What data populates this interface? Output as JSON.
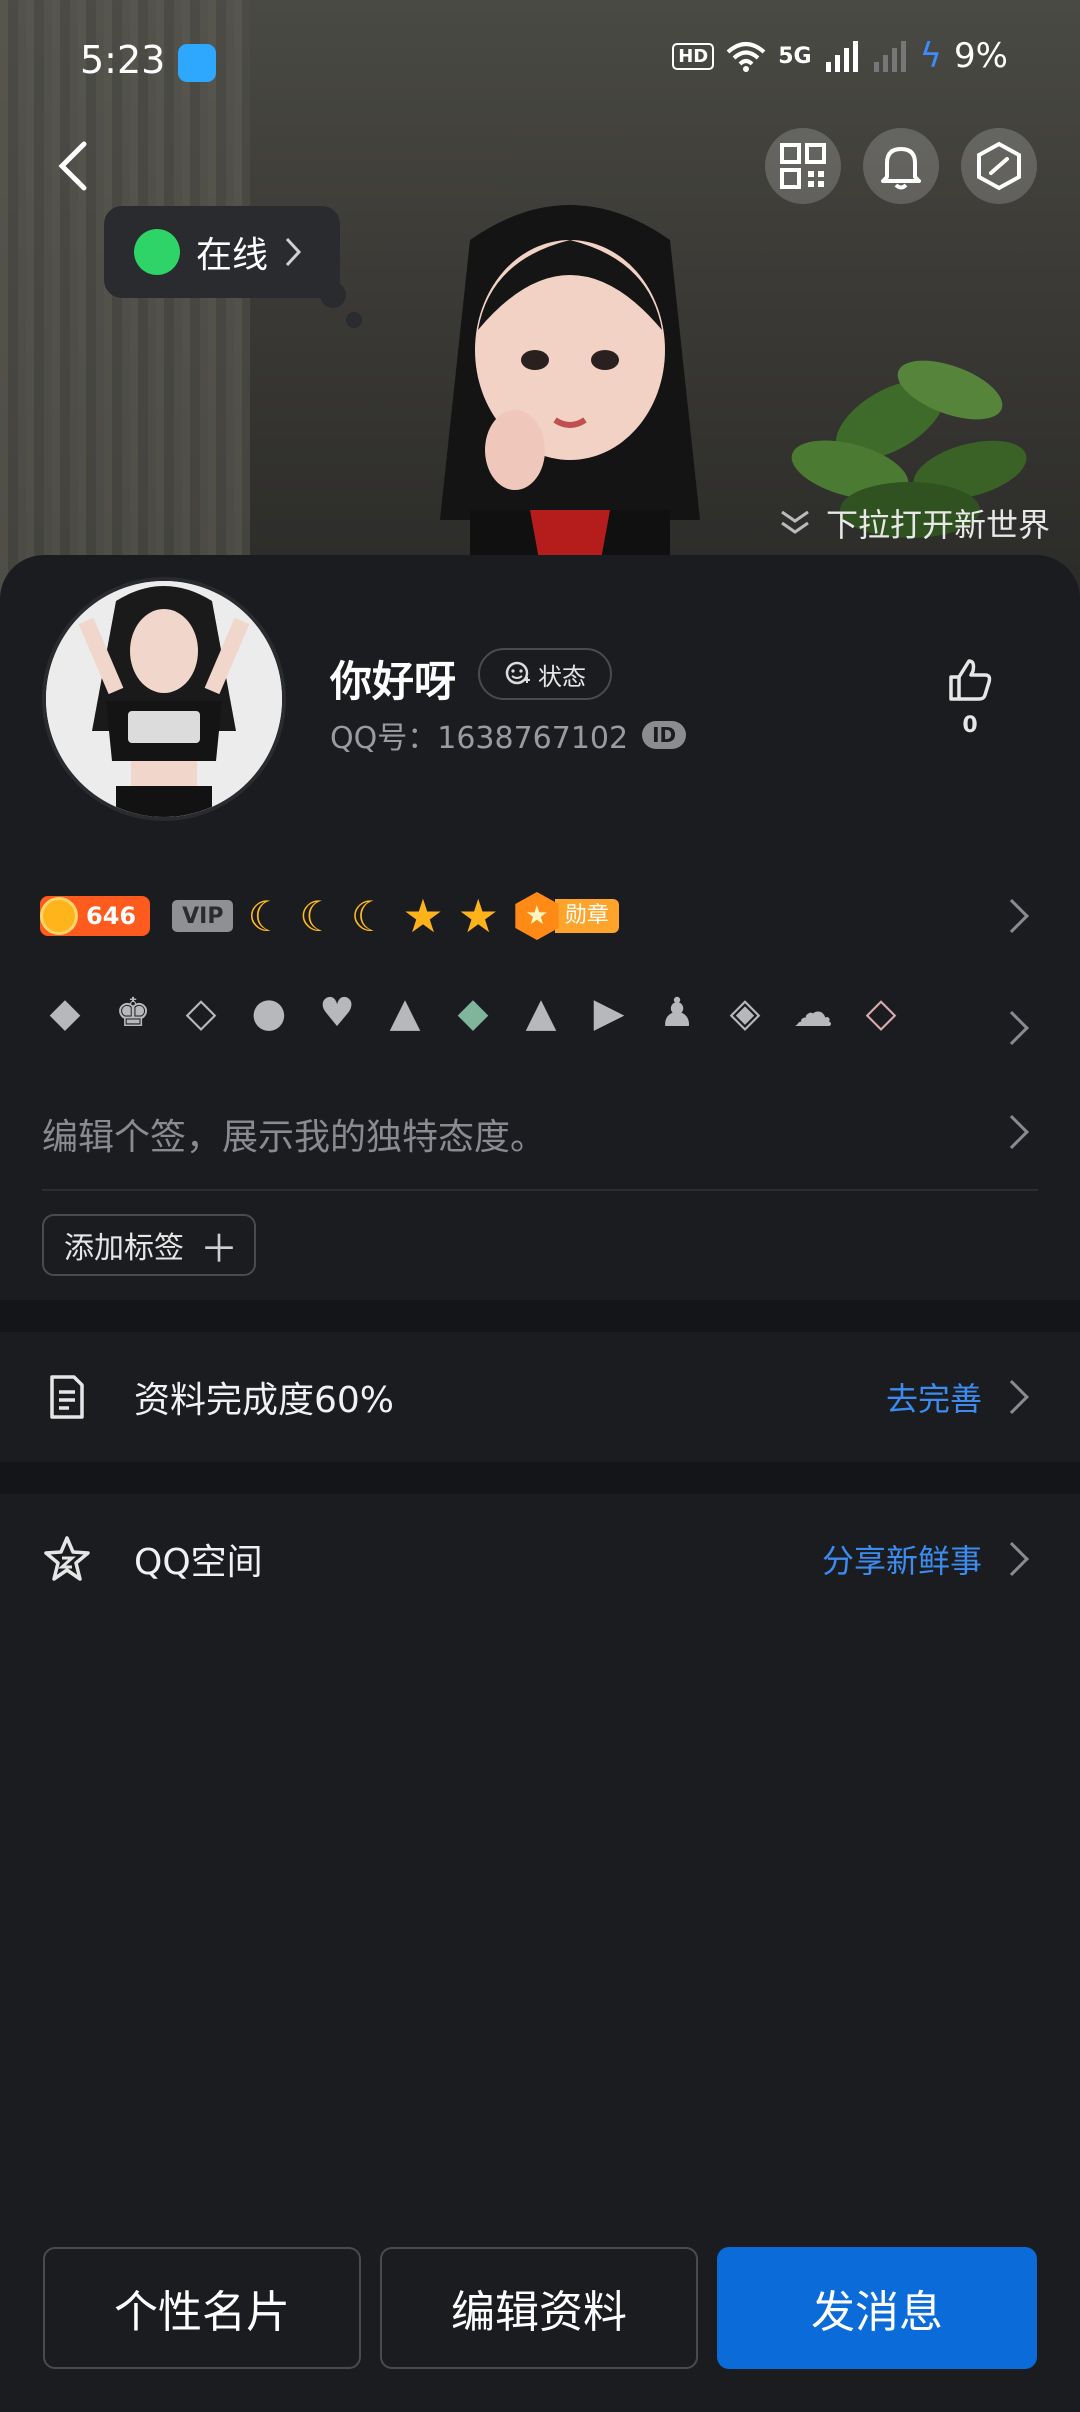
{
  "status_bar": {
    "time": "5:23",
    "network": "5G",
    "battery": "9%",
    "hd": "HD"
  },
  "header": {
    "online_status": "在线",
    "pull_hint": "下拉打开新世界"
  },
  "profile": {
    "nickname": "你好呀",
    "status_chip": "状态",
    "qq_label": "QQ号：1638767102",
    "id_tag": "ID",
    "likes": "0"
  },
  "level_row": {
    "coin_value": "646",
    "vip_label": "VIP",
    "medal_label": "勋章"
  },
  "signature_placeholder": "编辑个签，展示我的独特态度。",
  "add_tag_label": "添加标签",
  "rows": {
    "completeness_label": "资料完成度60%",
    "completeness_link": "去完善",
    "qzone_label": "QQ空间",
    "qzone_link": "分享新鲜事"
  },
  "bottom_buttons": {
    "card": "个性名片",
    "edit": "编辑资料",
    "message": "发消息"
  },
  "colors": {
    "accent": "#0a6bd9",
    "link": "#3c8cf0",
    "online": "#2ed468"
  }
}
